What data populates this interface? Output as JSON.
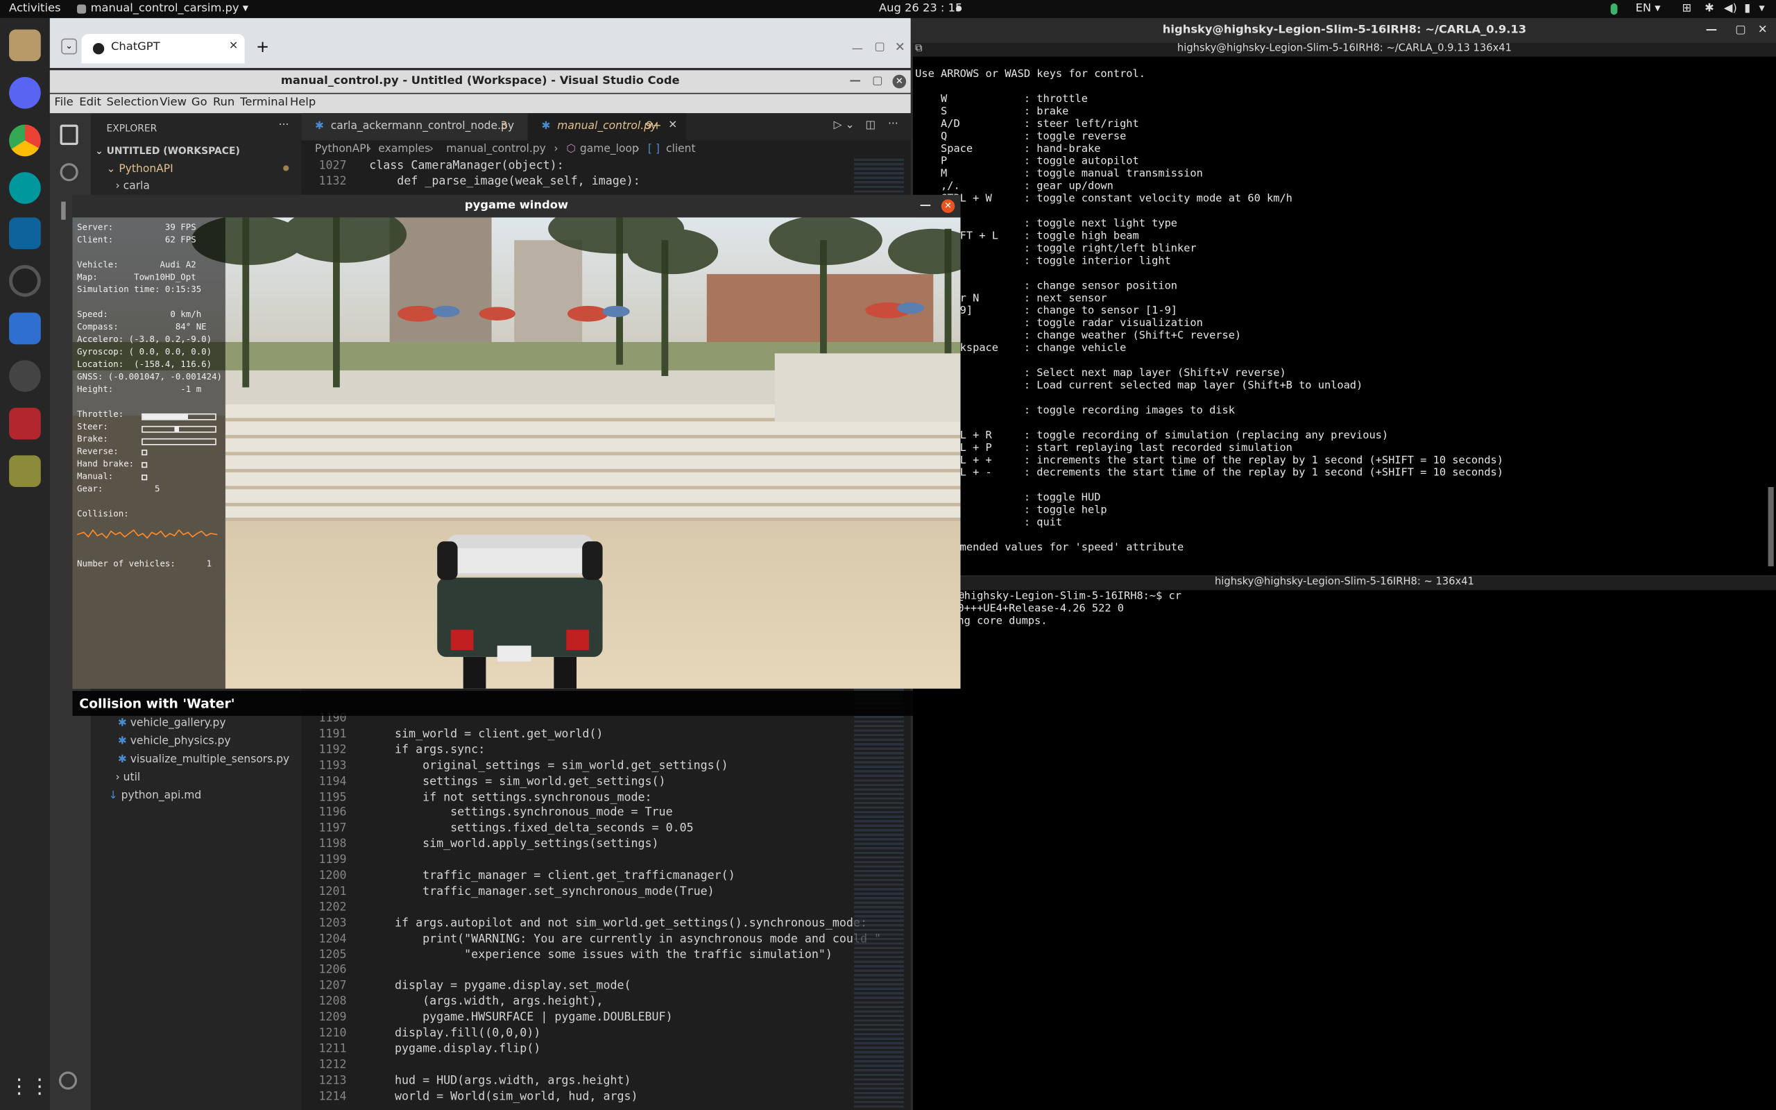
{
  "topbar": {
    "activities": "Activities",
    "app": "manual_control_carsim.py ▾",
    "clock": "Aug 26  23 : 15",
    "lang": "EN ▾"
  },
  "chrome": {
    "tab": "ChatGPT",
    "close": "×",
    "new_tab": "+"
  },
  "vscode": {
    "title": "manual_control.py - Untitled (Workspace) - Visual Studio Code",
    "menu": [
      "File",
      "Edit",
      "Selection",
      "View",
      "Go",
      "Run",
      "Terminal",
      "Help"
    ],
    "explorer_title": "EXPLORER",
    "workspace": "UNTITLED (WORKSPACE)",
    "tree": {
      "pythonapi": "PythonAPI",
      "carla": "carla",
      "files": [
        "vehicle_gallery.py",
        "vehicle_physics.py",
        "visualize_multiple_sensors.py"
      ],
      "util": "util",
      "readme": "python_api.md"
    },
    "tabs": [
      {
        "label": "carla_ackermann_control_node.py",
        "badge": "3"
      },
      {
        "label": "manual_control.py",
        "badge": "9+"
      }
    ],
    "breadcrumb": [
      "PythonAPI",
      "examples",
      "manual_control.py",
      "game_loop",
      "client"
    ],
    "top_lines": [
      {
        "n": "1027",
        "t": "class CameraManager(object):"
      },
      {
        "n": "1132",
        "t": "    def _parse_image(weak_self, image):"
      }
    ],
    "code": [
      {
        "n": "1190",
        "t": ""
      },
      {
        "n": "1191",
        "t": "    sim_world = client.get_world()"
      },
      {
        "n": "1192",
        "t": "    if args.sync:"
      },
      {
        "n": "1193",
        "t": "        original_settings = sim_world.get_settings()"
      },
      {
        "n": "1194",
        "t": "        settings = sim_world.get_settings()"
      },
      {
        "n": "1195",
        "t": "        if not settings.synchronous_mode:"
      },
      {
        "n": "1196",
        "t": "            settings.synchronous_mode = True"
      },
      {
        "n": "1197",
        "t": "            settings.fixed_delta_seconds = 0.05"
      },
      {
        "n": "1198",
        "t": "        sim_world.apply_settings(settings)"
      },
      {
        "n": "1199",
        "t": ""
      },
      {
        "n": "1200",
        "t": "        traffic_manager = client.get_trafficmanager()"
      },
      {
        "n": "1201",
        "t": "        traffic_manager.set_synchronous_mode(True)"
      },
      {
        "n": "1202",
        "t": ""
      },
      {
        "n": "1203",
        "t": "    if args.autopilot and not sim_world.get_settings().synchronous_mode:"
      },
      {
        "n": "1204",
        "t": "        print(\"WARNING: You are currently in asynchronous mode and could \""
      },
      {
        "n": "1205",
        "t": "              \"experience some issues with the traffic simulation\")"
      },
      {
        "n": "1206",
        "t": ""
      },
      {
        "n": "1207",
        "t": "    display = pygame.display.set_mode("
      },
      {
        "n": "1208",
        "t": "        (args.width, args.height),"
      },
      {
        "n": "1209",
        "t": "        pygame.HWSURFACE | pygame.DOUBLEBUF)"
      },
      {
        "n": "1210",
        "t": "    display.fill((0,0,0))"
      },
      {
        "n": "1211",
        "t": "    pygame.display.flip()"
      },
      {
        "n": "1212",
        "t": ""
      },
      {
        "n": "1213",
        "t": "    hud = HUD(args.width, args.height)"
      },
      {
        "n": "1214",
        "t": "    world = World(sim_world, hud, args)"
      }
    ]
  },
  "terminal": {
    "window_title": "highsky@highsky-Legion-Slim-5-16IRH8: ~/CARLA_0.9.13",
    "pane1_title": "highsky@highsky-Legion-Slim-5-16IRH8: ~/CARLA_0.9.13 136x41",
    "pane2_title": "highsky@highsky-Legion-Slim-5-16IRH8: ~ 136x41",
    "pane1_lines": [
      "Use ARROWS or WASD keys for control.",
      "",
      "    W            : throttle",
      "    S            : brake",
      "    A/D          : steer left/right",
      "    Q            : toggle reverse",
      "    Space        : hand-brake",
      "    P            : toggle autopilot",
      "    M            : toggle manual transmission",
      "    ,/.          : gear up/down",
      "    CTRL + W     : toggle constant velocity mode at 60 km/h",
      "",
      "    L            : toggle next light type",
      "    SHIFT + L    : toggle high beam",
      "    Z/X          : toggle right/left blinker",
      "    I            : toggle interior light",
      "",
      "    TAB          : change sensor position",
      "    ` or N       : next sensor",
      "    [1-9]        : change to sensor [1-9]",
      "    G            : toggle radar visualization",
      "    C            : change weather (Shift+C reverse)",
      "    Backspace    : change vehicle",
      "",
      "    V/B          : Select next map layer (Shift+V reverse)",
      "                 : Load current selected map layer (Shift+B to unload)",
      "",
      "    R            : toggle recording images to disk",
      "",
      "    CTRL + R     : toggle recording of simulation (replacing any previous)",
      "    CTRL + P     : start replaying last recorded simulation",
      "    CTRL + +     : increments the start time of the replay by 1 second (+SHIFT = 10 seconds)",
      "    CTRL + -     : decrements the start time of the replay by 1 second (+SHIFT = 10 seconds)",
      "",
      "    F1           : toggle HUD",
      "    H/?          : toggle help",
      "    ESC          : quit",
      "",
      "  Recommended values for 'speed' attribute"
    ],
    "pane2_lines": [
      "highsky@highsky-Legion-Slim-5-16IRH8:~$ cr",
      "4.26.2-0+++UE4+Release-4.26 522 0",
      "Disabling core dumps."
    ]
  },
  "pygame": {
    "title": "pygame window",
    "hud": {
      "server": "Server:          39 FPS",
      "client": "Client:          62 FPS",
      "vehicle": "Vehicle:        Audi A2",
      "map": "Map:       Town10HD_Opt",
      "sim_time": "Simulation time: 0:15:35",
      "speed": "Speed:            0 km/h",
      "compass": "Compass:           84° NE",
      "accel": "Accelero: (-3.8, 0.2,-9.0)",
      "gyro": "Gyroscop: ( 0.0, 0.0, 0.0)",
      "location": "Location:  (-158.4, 116.6)",
      "gnss": "GNSS: (-0.001047, -0.001424)",
      "height": "Height:             -1 m",
      "throttle": "Throttle:",
      "steer": "Steer:",
      "brake": "Brake:",
      "reverse": "Reverse:",
      "handbrake": "Hand brake:",
      "manual": "Manual:",
      "gear": "Gear:          5",
      "collision": "Collision:",
      "vehicles": "Number of vehicles:      1"
    },
    "notification": "Collision with 'Water'"
  }
}
